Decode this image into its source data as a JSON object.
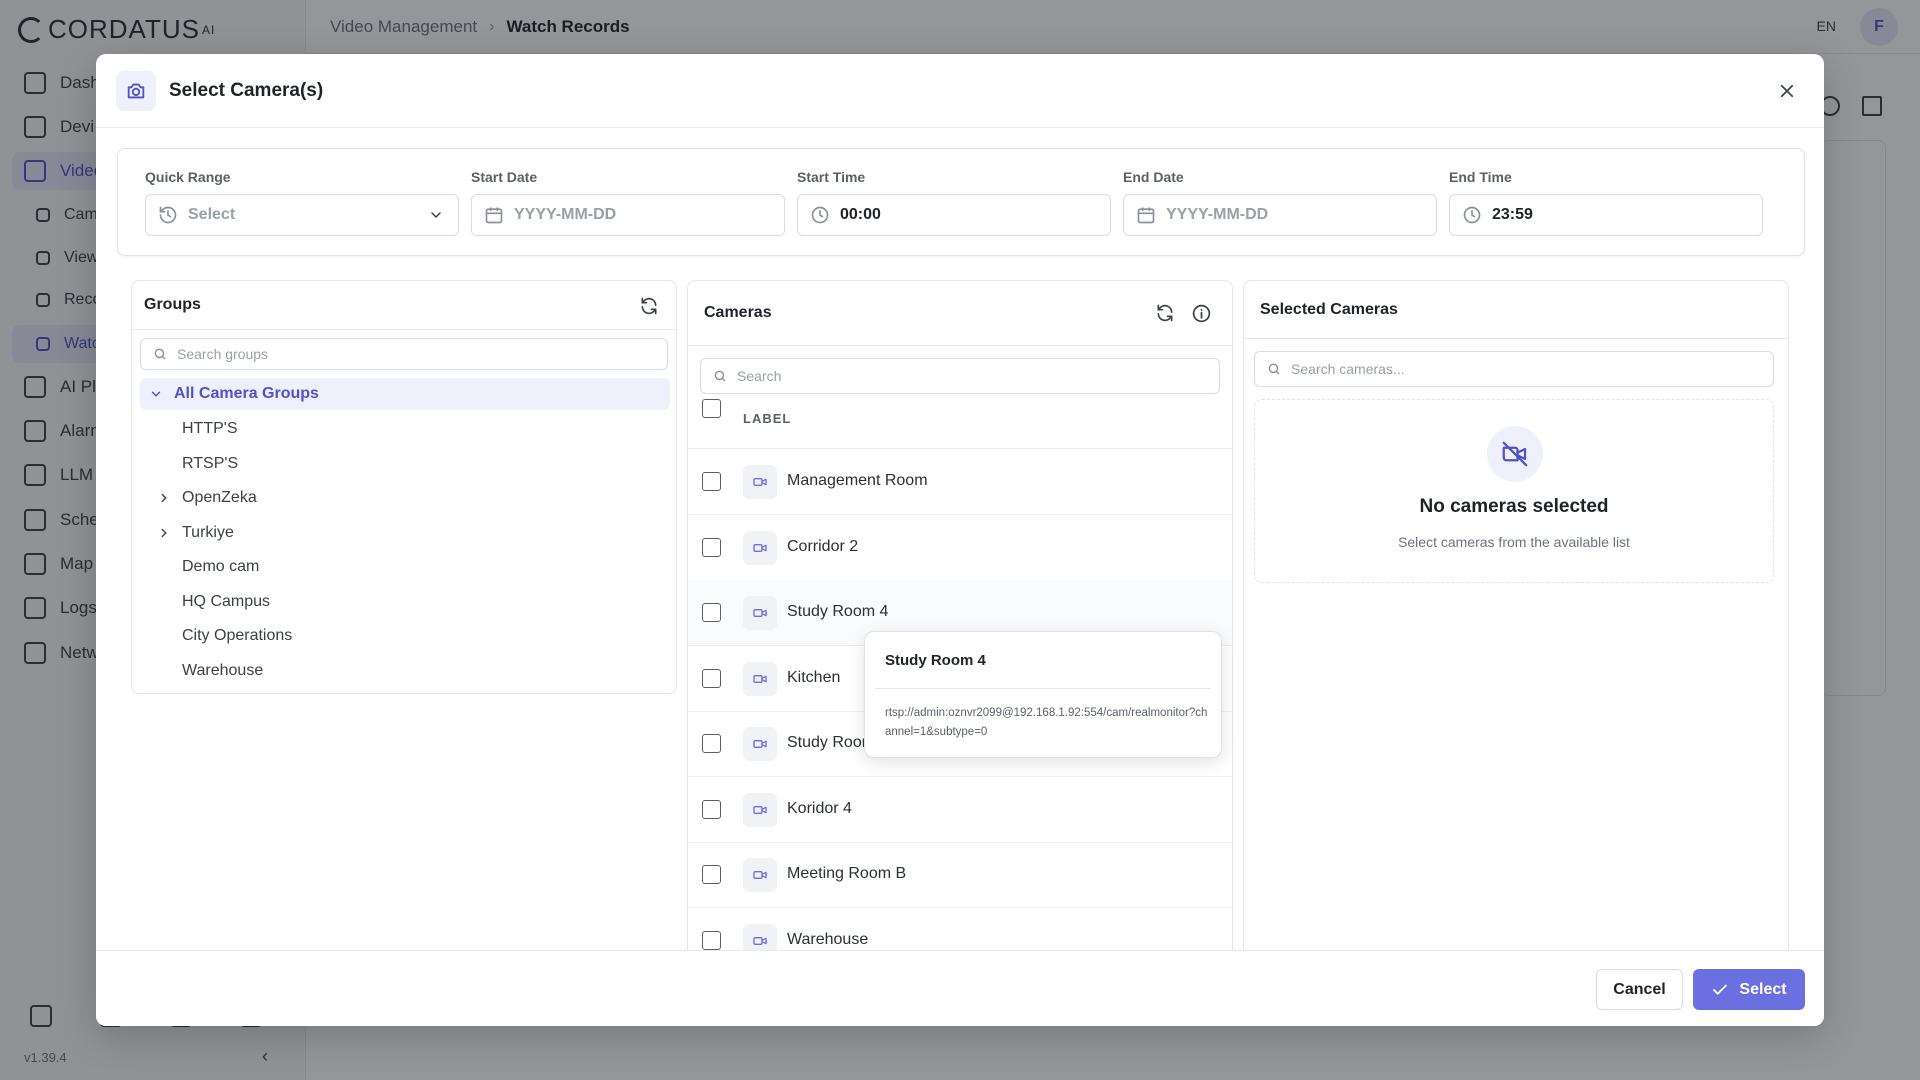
{
  "app": {
    "brand": "CORDATUS",
    "brand_sup": "AI",
    "version": "v1.39.4",
    "language": "EN",
    "user_initial": "F"
  },
  "breadcrumb": {
    "parent": "Video Management",
    "current": "Watch Records"
  },
  "sidebar": {
    "items": [
      {
        "label": "Dash",
        "icon": "dashboard-icon"
      },
      {
        "label": "Devi",
        "icon": "devices-icon"
      },
      {
        "label": "Video",
        "icon": "video-camera-icon"
      },
      {
        "label": "Cam",
        "icon": "camera-icon"
      },
      {
        "label": "View",
        "icon": "grid-icon"
      },
      {
        "label": "Reco",
        "icon": "list-icon"
      },
      {
        "label": "Watc",
        "icon": "monitor-icon"
      },
      {
        "label": "AI Pl",
        "icon": "ai-icon"
      },
      {
        "label": "Alarm",
        "icon": "bell-icon"
      },
      {
        "label": "LLM",
        "icon": "cube-icon"
      },
      {
        "label": "Sche",
        "icon": "schedule-icon"
      },
      {
        "label": "Map",
        "icon": "map-icon"
      },
      {
        "label": "Logs",
        "icon": "document-icon"
      },
      {
        "label": "Netw",
        "icon": "network-icon"
      }
    ]
  },
  "modal": {
    "title": "Select Camera(s)",
    "header_icon": "camera-icon",
    "filters": {
      "quick_range": {
        "label": "Quick Range",
        "placeholder": "Select"
      },
      "start_date": {
        "label": "Start Date",
        "placeholder": "YYYY-MM-DD"
      },
      "start_time": {
        "label": "Start Time",
        "value": "00:00"
      },
      "end_date": {
        "label": "End Date",
        "placeholder": "YYYY-MM-DD"
      },
      "end_time": {
        "label": "End Time",
        "value": "23:59"
      }
    },
    "groups": {
      "title": "Groups",
      "search_placeholder": "Search groups",
      "items": [
        {
          "label": "All Camera Groups",
          "expandable": true,
          "expanded": true,
          "selected": true
        },
        {
          "label": "HTTP'S"
        },
        {
          "label": "RTSP'S"
        },
        {
          "label": "OpenZeka",
          "expandable": true
        },
        {
          "label": "Turkiye",
          "expandable": true
        },
        {
          "label": "Demo cam"
        },
        {
          "label": "HQ Campus"
        },
        {
          "label": "City Operations"
        },
        {
          "label": "Warehouse"
        }
      ]
    },
    "cameras": {
      "title": "Cameras",
      "search_placeholder": "Search",
      "column_label": "LABEL",
      "rows": [
        {
          "label": "Management Room"
        },
        {
          "label": "Corridor 2"
        },
        {
          "label": "Study Room 4"
        },
        {
          "label": "Kitchen"
        },
        {
          "label": "Study Roor"
        },
        {
          "label": "Koridor 4"
        },
        {
          "label": "Meeting Room B"
        },
        {
          "label": "Warehouse"
        }
      ],
      "tooltip": {
        "title": "Study Room 4",
        "url": "rtsp://admin:oznvr2099@192.168.1.92:554/cam/realmonitor?channel=1&subtype=0"
      }
    },
    "selected": {
      "title": "Selected Cameras",
      "search_placeholder": "Search cameras...",
      "empty_title": "No cameras selected",
      "empty_subtitle": "Select cameras from the available list"
    },
    "footer": {
      "cancel_label": "Cancel",
      "select_label": "Select"
    }
  },
  "colors": {
    "accent": "#6c6fe0",
    "accent_text": "#4f52c9",
    "accent_bg": "#eef0fc"
  }
}
